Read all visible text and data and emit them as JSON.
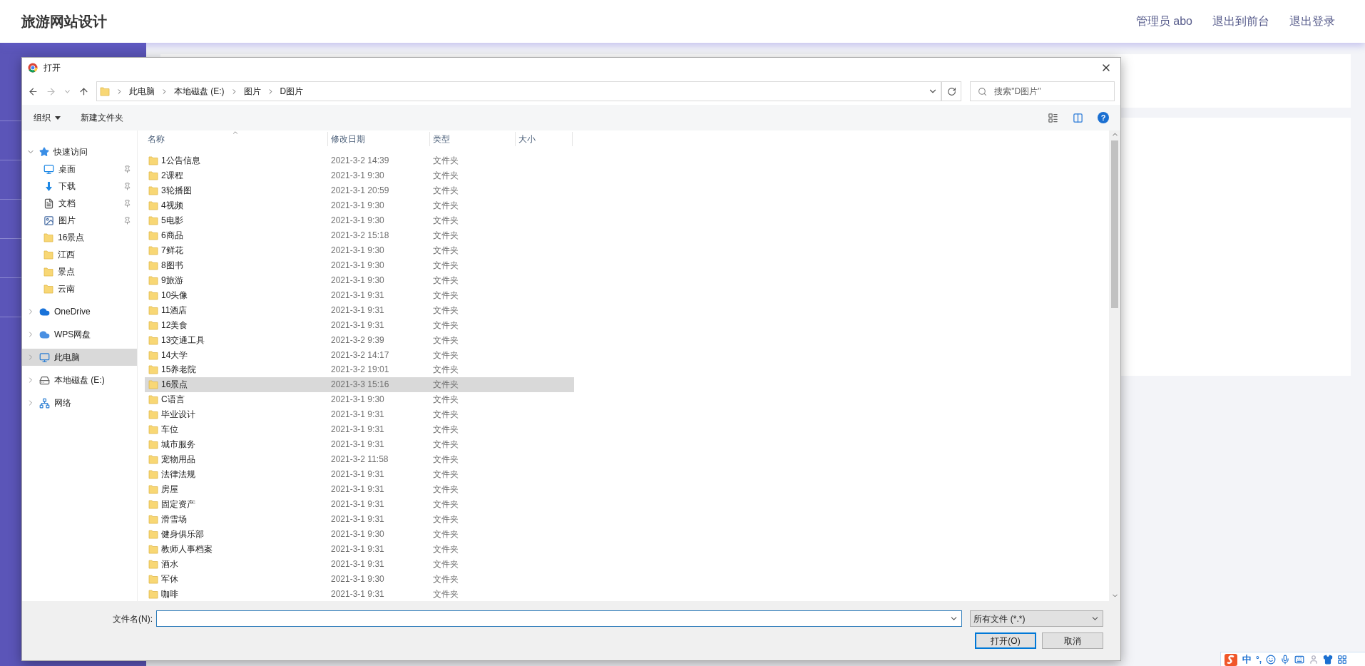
{
  "header": {
    "title": "旅游网站设计",
    "links": [
      "管理员 abo",
      "退出到前台",
      "退出登录"
    ]
  },
  "dialog": {
    "title": "打开",
    "address": {
      "crumbs": [
        "此电脑",
        "本地磁盘 (E:)",
        "图片",
        "D图片"
      ]
    },
    "search": {
      "placeholder": "搜索\"D图片\""
    },
    "toolbar": {
      "organize": "组织",
      "new_folder": "新建文件夹",
      "help": "?"
    },
    "nav": [
      {
        "label": "快速访问",
        "kind": "star",
        "expanded": true,
        "selected": false,
        "children": [
          {
            "label": "桌面",
            "kind": "desktop",
            "pinned": true
          },
          {
            "label": "下载",
            "kind": "download",
            "pinned": true
          },
          {
            "label": "文档",
            "kind": "document",
            "pinned": true
          },
          {
            "label": "图片",
            "kind": "picture",
            "pinned": true
          },
          {
            "label": "16景点",
            "kind": "folder",
            "pinned": false
          },
          {
            "label": "江西",
            "kind": "folder",
            "pinned": false
          },
          {
            "label": "景点",
            "kind": "folder",
            "pinned": false
          },
          {
            "label": "云南",
            "kind": "folder",
            "pinned": false
          }
        ]
      },
      {
        "label": "OneDrive",
        "kind": "onedrive",
        "expanded": false,
        "selected": false
      },
      {
        "label": "WPS网盘",
        "kind": "cloud",
        "expanded": false,
        "selected": false
      },
      {
        "label": "此电脑",
        "kind": "pc",
        "expanded": false,
        "selected": true
      },
      {
        "label": "本地磁盘 (E:)",
        "kind": "drive",
        "expanded": false,
        "selected": false
      },
      {
        "label": "网络",
        "kind": "network",
        "expanded": false,
        "selected": false
      }
    ],
    "columns": [
      "名称",
      "修改日期",
      "类型",
      "大小"
    ],
    "files": [
      {
        "name": "1公告信息",
        "date": "2021-3-2 14:39",
        "type": "文件夹",
        "selected": false
      },
      {
        "name": "2课程",
        "date": "2021-3-1 9:30",
        "type": "文件夹",
        "selected": false
      },
      {
        "name": "3轮播图",
        "date": "2021-3-1 20:59",
        "type": "文件夹",
        "selected": false
      },
      {
        "name": "4视频",
        "date": "2021-3-1 9:30",
        "type": "文件夹",
        "selected": false
      },
      {
        "name": "5电影",
        "date": "2021-3-1 9:30",
        "type": "文件夹",
        "selected": false
      },
      {
        "name": "6商品",
        "date": "2021-3-2 15:18",
        "type": "文件夹",
        "selected": false
      },
      {
        "name": "7鲜花",
        "date": "2021-3-1 9:30",
        "type": "文件夹",
        "selected": false
      },
      {
        "name": "8图书",
        "date": "2021-3-1 9:30",
        "type": "文件夹",
        "selected": false
      },
      {
        "name": "9旅游",
        "date": "2021-3-1 9:30",
        "type": "文件夹",
        "selected": false
      },
      {
        "name": "10头像",
        "date": "2021-3-1 9:31",
        "type": "文件夹",
        "selected": false
      },
      {
        "name": "11酒店",
        "date": "2021-3-1 9:31",
        "type": "文件夹",
        "selected": false
      },
      {
        "name": "12美食",
        "date": "2021-3-1 9:31",
        "type": "文件夹",
        "selected": false
      },
      {
        "name": "13交通工具",
        "date": "2021-3-2 9:39",
        "type": "文件夹",
        "selected": false
      },
      {
        "name": "14大学",
        "date": "2021-3-2 14:17",
        "type": "文件夹",
        "selected": false
      },
      {
        "name": "15养老院",
        "date": "2021-3-2 19:01",
        "type": "文件夹",
        "selected": false
      },
      {
        "name": "16景点",
        "date": "2021-3-3 15:16",
        "type": "文件夹",
        "selected": true
      },
      {
        "name": "C语言",
        "date": "2021-3-1 9:30",
        "type": "文件夹",
        "selected": false
      },
      {
        "name": "毕业设计",
        "date": "2021-3-1 9:31",
        "type": "文件夹",
        "selected": false
      },
      {
        "name": "车位",
        "date": "2021-3-1 9:31",
        "type": "文件夹",
        "selected": false
      },
      {
        "name": "城市服务",
        "date": "2021-3-1 9:31",
        "type": "文件夹",
        "selected": false
      },
      {
        "name": "宠物用品",
        "date": "2021-3-2 11:58",
        "type": "文件夹",
        "selected": false
      },
      {
        "name": "法律法规",
        "date": "2021-3-1 9:31",
        "type": "文件夹",
        "selected": false
      },
      {
        "name": "房屋",
        "date": "2021-3-1 9:31",
        "type": "文件夹",
        "selected": false
      },
      {
        "name": "固定资产",
        "date": "2021-3-1 9:31",
        "type": "文件夹",
        "selected": false
      },
      {
        "name": "滑雪场",
        "date": "2021-3-1 9:31",
        "type": "文件夹",
        "selected": false
      },
      {
        "name": "健身俱乐部",
        "date": "2021-3-1 9:30",
        "type": "文件夹",
        "selected": false
      },
      {
        "name": "教师人事档案",
        "date": "2021-3-1 9:31",
        "type": "文件夹",
        "selected": false
      },
      {
        "name": "酒水",
        "date": "2021-3-1 9:31",
        "type": "文件夹",
        "selected": false
      },
      {
        "name": "军休",
        "date": "2021-3-1 9:30",
        "type": "文件夹",
        "selected": false
      },
      {
        "name": "咖啡",
        "date": "2021-3-1 9:31",
        "type": "文件夹",
        "selected": false
      }
    ],
    "filename": {
      "label": "文件名(N):"
    },
    "filter": "所有文件 (*.*)",
    "buttons": [
      "打开(O)",
      "取消"
    ]
  },
  "ime": {
    "mode": "中",
    "punct": "°,"
  }
}
